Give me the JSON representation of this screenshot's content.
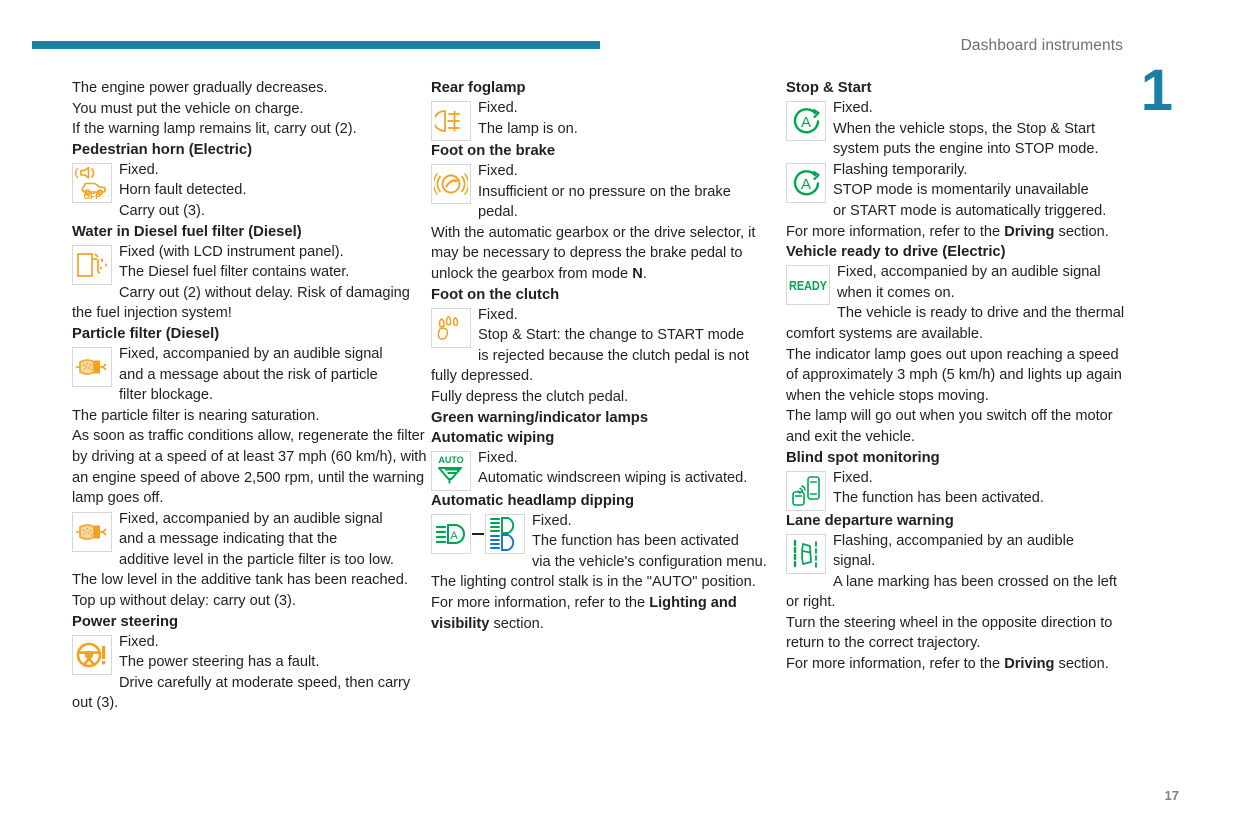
{
  "header": {
    "title": "Dashboard instruments",
    "chapter": "1",
    "page": "17"
  },
  "column1": {
    "intro": [
      "The engine power gradually decreases.",
      "You must put the vehicle on charge.",
      "If the warning lamp remains lit, carry out (2)."
    ],
    "sections": [
      {
        "heading": "Pedestrian horn (Electric)",
        "icon": "pedestrian-horn-off-icon",
        "icon_label": "OFF",
        "lines": [
          "Fixed.",
          "Horn fault detected."
        ],
        "after": [
          "Carry out (3)."
        ]
      },
      {
        "heading": "Water in Diesel fuel filter (Diesel)",
        "icon": "diesel-fuel-filter-water-icon",
        "lines": [
          "Fixed (with LCD instrument panel).",
          "The Diesel fuel filter contains water."
        ],
        "after": [
          "Carry out (2) without delay. Risk of damaging the fuel injection system!"
        ]
      },
      {
        "heading": "Particle filter (Diesel)",
        "icon": "particle-filter-icon",
        "lines": [
          "Fixed, accompanied by an audible signal",
          "and a message about the risk of particle"
        ],
        "after": [
          "filter blockage.",
          "The particle filter is nearing saturation.",
          "As soon as traffic conditions allow, regenerate the filter by driving at a speed of at least 37 mph (60 km/h), with an engine speed of above 2,500 rpm, until the warning lamp goes off."
        ]
      },
      {
        "heading": "",
        "icon": "particle-filter-icon",
        "lines": [
          "Fixed, accompanied by an audible signal",
          "and a message indicating that the"
        ],
        "after": [
          "additive level in the particle filter is too low.",
          "The low level in the additive tank has been reached.",
          "Top up without delay: carry out (3)."
        ]
      },
      {
        "heading": "Power steering",
        "icon": "power-steering-icon",
        "lines": [
          "Fixed.",
          "The power steering has a fault."
        ],
        "after": [
          "Drive carefully at moderate speed, then carry out (3)."
        ]
      }
    ]
  },
  "column2": {
    "sections": [
      {
        "heading": "Rear foglamp",
        "icon": "rear-foglamp-icon",
        "lines": [
          "Fixed.",
          "The lamp is on."
        ],
        "after": []
      },
      {
        "heading": "Foot on the brake",
        "icon": "foot-on-brake-icon",
        "lines": [
          "Fixed.",
          "Insufficient or no pressure on the brake"
        ],
        "after_html": [
          "pedal.",
          "With the automatic gearbox or the drive selector, it may be necessary to depress the brake pedal to unlock the gearbox from mode <b>N</b>."
        ]
      },
      {
        "heading": "Foot on the clutch",
        "icon": "foot-on-clutch-icon",
        "lines": [
          "Fixed.",
          "Stop &amp; Start: the change to START mode"
        ],
        "after_html": [
          "is rejected because the clutch pedal is not fully depressed.",
          "Fully depress the clutch pedal."
        ]
      }
    ],
    "green_heading": "Green warning/indicator lamps",
    "green_sections": [
      {
        "heading": "Automatic wiping",
        "icon": "automatic-wiping-icon",
        "icon_label": "AUTO",
        "lines": [
          "Fixed.",
          "Automatic windscreen wiping is activated."
        ],
        "after_html": []
      },
      {
        "heading": "Automatic headlamp dipping",
        "icon": "automatic-headlamp-dipping-icon",
        "icon2": "headlamp-beam-switch-icon",
        "lines": [
          "Fixed.",
          "The function has been activated"
        ],
        "after_html": [
          "via the vehicle's configuration menu.",
          "The lighting control stalk is in the \"AUTO\" position.",
          "For more information, refer to the <b>Lighting and visibility</b> section."
        ]
      }
    ]
  },
  "column3": {
    "sections": [
      {
        "heading": "Stop &amp; Start",
        "icon": "stop-start-icon",
        "lines": [
          "Fixed.",
          "When the vehicle stops, the Stop &amp; Start"
        ],
        "after_html": [
          "system puts the engine into STOP mode."
        ]
      },
      {
        "heading": "",
        "icon": "stop-start-icon",
        "lines": [
          "Flashing temporarily.",
          "STOP mode is momentarily unavailable"
        ],
        "after_html": [
          "or START mode is automatically triggered.",
          "For more information, refer to the <b>Driving</b> section."
        ]
      },
      {
        "heading": "Vehicle ready to drive (Electric)",
        "icon": "vehicle-ready-icon",
        "icon_label": "READY",
        "lines": [
          "Fixed, accompanied by an audible signal",
          "when it comes on."
        ],
        "after_html": [
          "The vehicle is ready to drive and the thermal comfort systems are available.",
          "The indicator lamp goes out upon reaching a speed of approximately 3 mph (5 km/h) and lights up again when the vehicle stops moving.",
          "The lamp will go out when you switch off the motor and exit the vehicle."
        ]
      },
      {
        "heading": "Blind spot monitoring",
        "icon": "blind-spot-monitoring-icon",
        "lines": [
          "Fixed.",
          "The function has been activated."
        ],
        "after_html": []
      },
      {
        "heading": "Lane departure warning",
        "icon": "lane-departure-warning-icon",
        "lines": [
          "Flashing, accompanied by an audible",
          "signal."
        ],
        "after_html": [
          "A lane marking has been crossed on the left or right.",
          "Turn the steering wheel in the opposite direction to return to the correct trajectory.",
          "For more information, refer to the <b>Driving</b> section."
        ]
      }
    ]
  },
  "colors": {
    "accent": "#1b7fa3",
    "amber": "#F5A11F",
    "green": "#00A550",
    "text": "#231f20",
    "muted": "#6d6e71"
  }
}
